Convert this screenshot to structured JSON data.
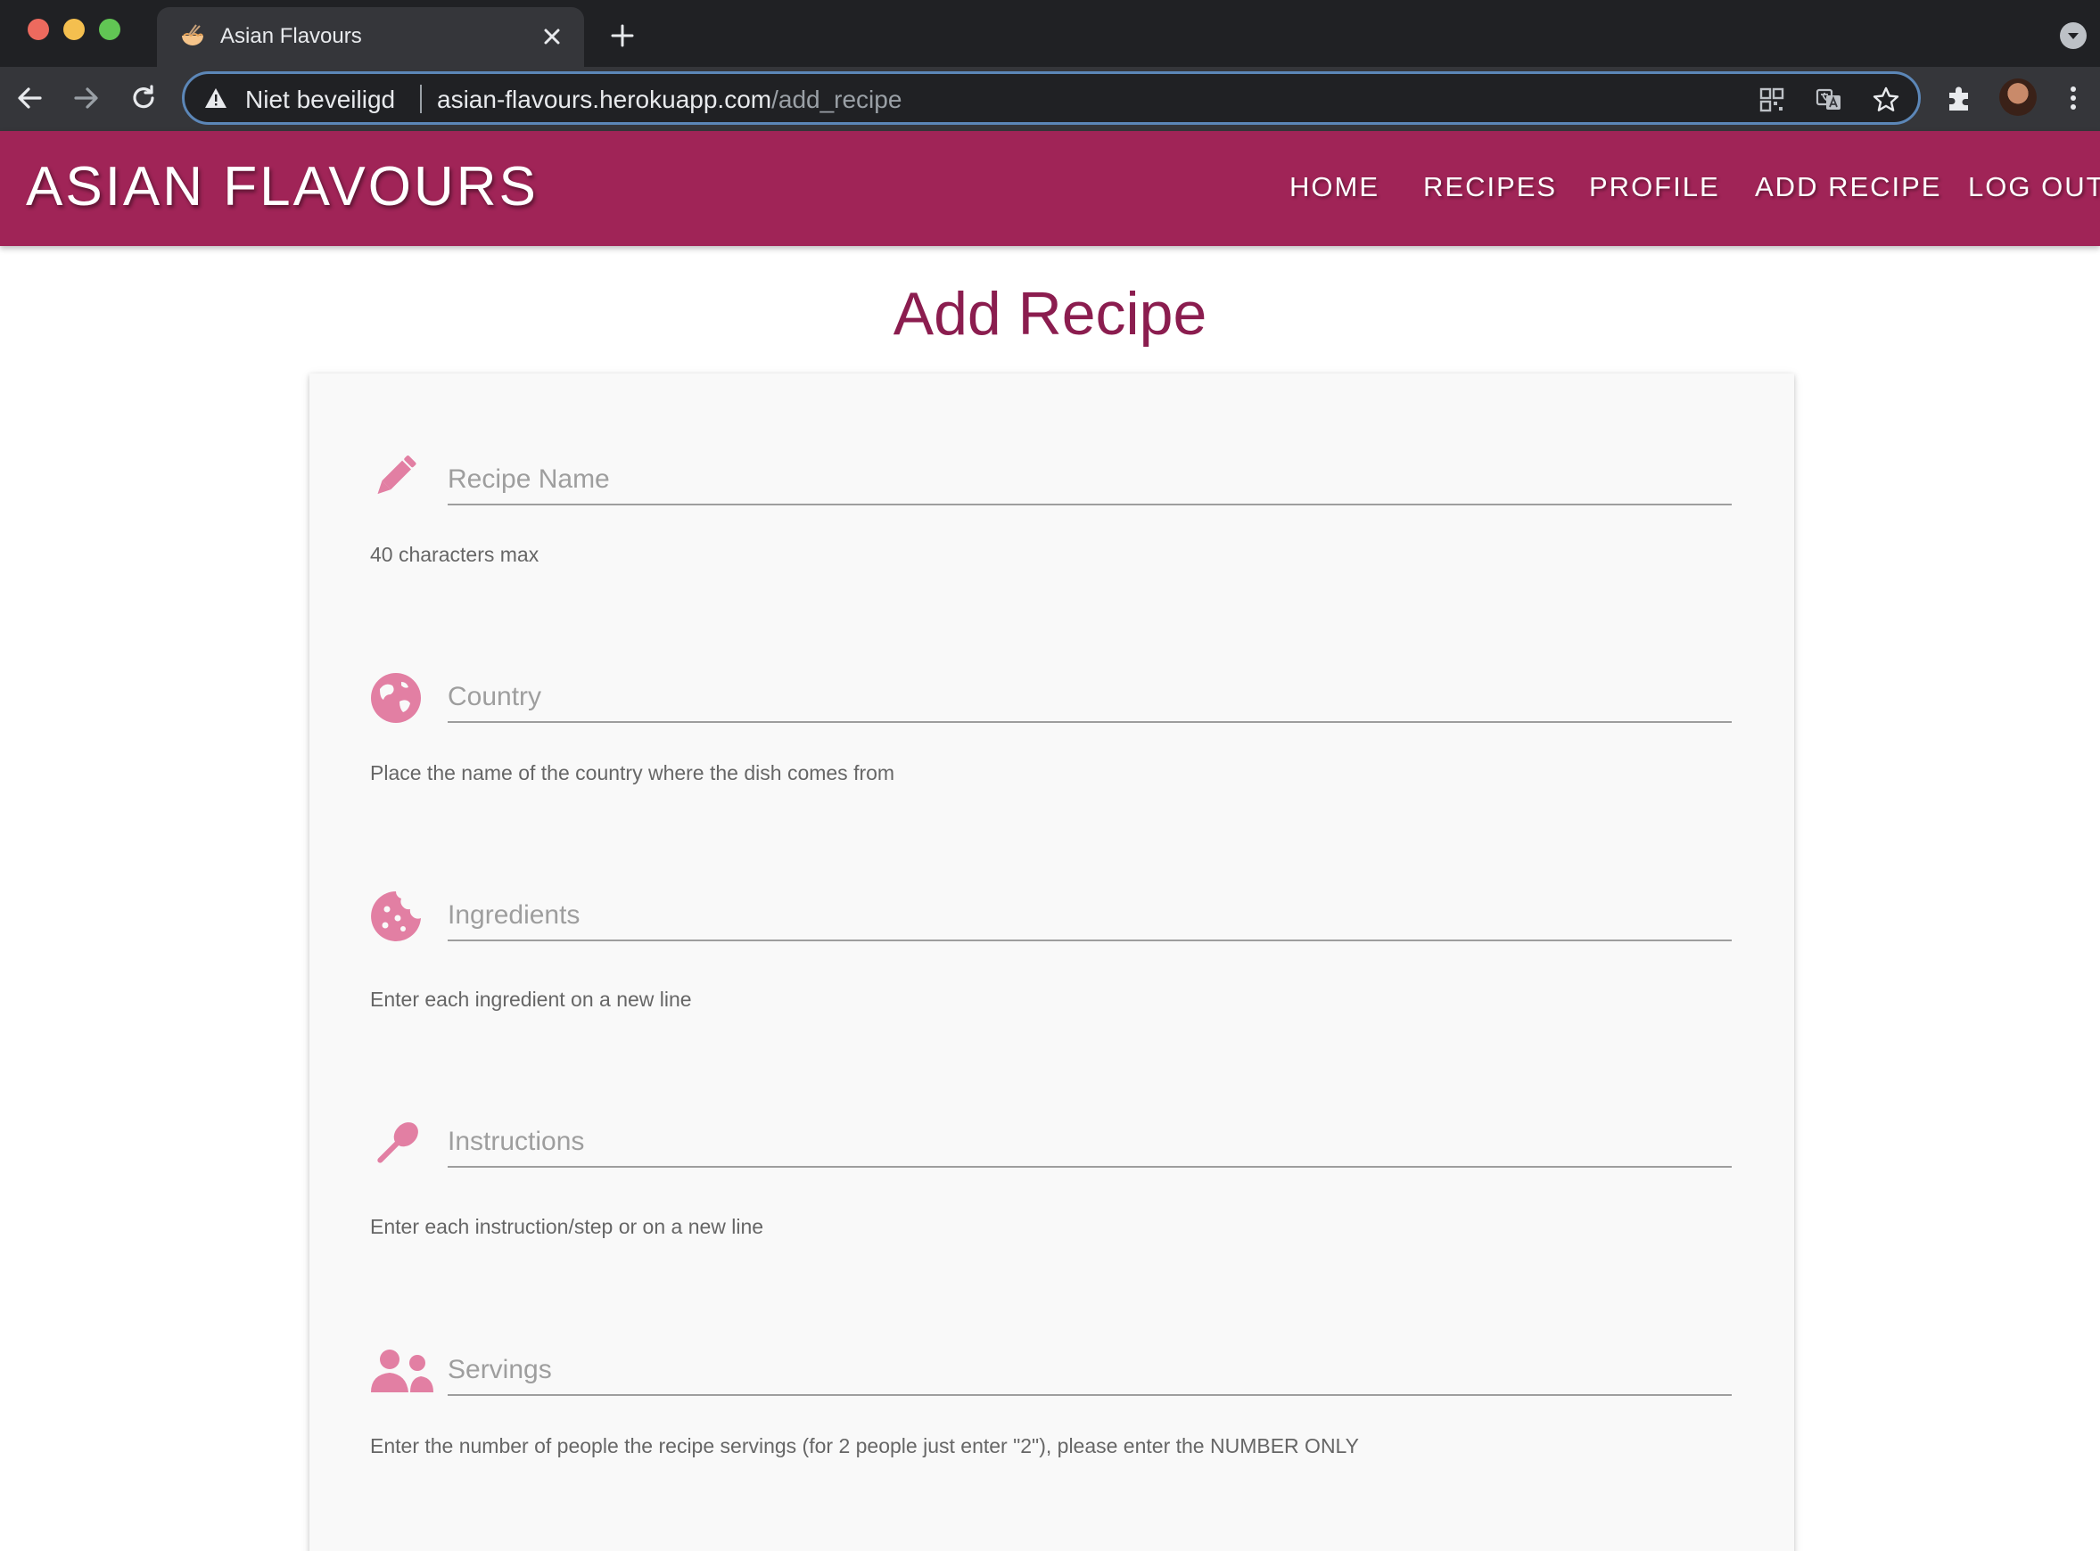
{
  "browser": {
    "tab_title": "Asian Flavours",
    "security_label": "Niet beveiligd",
    "url_host": "asian-flavours.herokuapp.com",
    "url_path": "/add_recipe"
  },
  "site": {
    "brand": "ASIAN FLAVOURS",
    "nav": {
      "home": "HOME",
      "recipes": "RECIPES",
      "profile": "PROFILE",
      "add_recipe": "ADD RECIPE",
      "logout": "LOG OUT"
    },
    "nav_color": "#a02457",
    "accent_color": "#8b1d4f",
    "icon_color": "#e27fa3"
  },
  "page": {
    "title": "Add Recipe"
  },
  "form": {
    "recipe_name": {
      "placeholder": "Recipe Name",
      "value": "",
      "helper": "40 characters max",
      "icon": "pencil-icon"
    },
    "country": {
      "placeholder": "Country",
      "value": "",
      "helper": "Place the name of the country where the dish comes from",
      "icon": "globe-icon"
    },
    "ingredients": {
      "placeholder": "Ingredients",
      "value": "",
      "helper": "Enter each ingredient on a new line",
      "icon": "cookie-icon"
    },
    "instructions": {
      "placeholder": "Instructions",
      "value": "",
      "helper": "Enter each instruction/step or on a new line",
      "icon": "spoon-icon"
    },
    "servings": {
      "placeholder": "Servings",
      "value": "",
      "helper": "Enter the number of people the recipe servings (for 2 people just enter \"2\"), please enter the NUMBER ONLY",
      "icon": "users-icon"
    }
  }
}
